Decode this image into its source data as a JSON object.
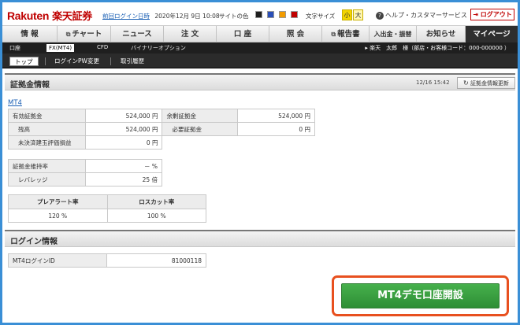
{
  "header": {
    "brand": "Rakuten",
    "brand_jp": "楽天証券",
    "last_login_label": "前回ログイン日時",
    "last_login_value": "2020年12月 9日 10:08",
    "theme_label": "サイトの色",
    "theme_colors": [
      "#1e1e1e",
      "#2a4fb8",
      "#f29b00",
      "#c00000"
    ],
    "font_size_label": "文字サイズ",
    "font_size_small": "小",
    "font_size_large": "大",
    "help_label": "ヘルプ・カスタマーサービス",
    "logout_label": "ログアウト"
  },
  "main_nav": [
    "情 報",
    "チャート",
    "ニュース",
    "注 文",
    "口 座",
    "照 会",
    "報告書",
    "入出金・振替",
    "お知らせ",
    "マイページ"
  ],
  "sub_nav": {
    "items": [
      "口座",
      "FX(MT4)",
      "CFD",
      "バイナリーオプション"
    ],
    "user": "▸ 楽天　太郎　様（部店・お客様コード：000-000000 ）"
  },
  "tabs": [
    "トップ",
    "ログインPW変更",
    "取引履歴"
  ],
  "margin_section": {
    "title": "証拠金情報",
    "timestamp": "12/16 15:42",
    "refresh_label": "証拠金情報更新",
    "account_link": "MT4",
    "rows": [
      {
        "label": "有効証拠金",
        "value": "524,000 円",
        "label2": "余剰証拠金",
        "value2": "524,000 円"
      },
      {
        "label": "残高",
        "value": "524,000 円",
        "label2": "必要証拠金",
        "value2": "0 円"
      },
      {
        "label": "未決済建玉評価損益",
        "value": "0 円"
      }
    ],
    "ratio_rows": [
      {
        "label": "証拠金維持率",
        "value": "－ %"
      },
      {
        "label": "レバレッジ",
        "value": "25 倍"
      }
    ],
    "alert_headers": [
      "プレアラート率",
      "ロスカット率"
    ],
    "alert_values": [
      "120 %",
      "100 %"
    ]
  },
  "login_section": {
    "title": "ログイン情報",
    "id_label": "MT4ログインID",
    "id_value": "81000118"
  },
  "cta": {
    "label": "MT4デモ口座開設"
  }
}
